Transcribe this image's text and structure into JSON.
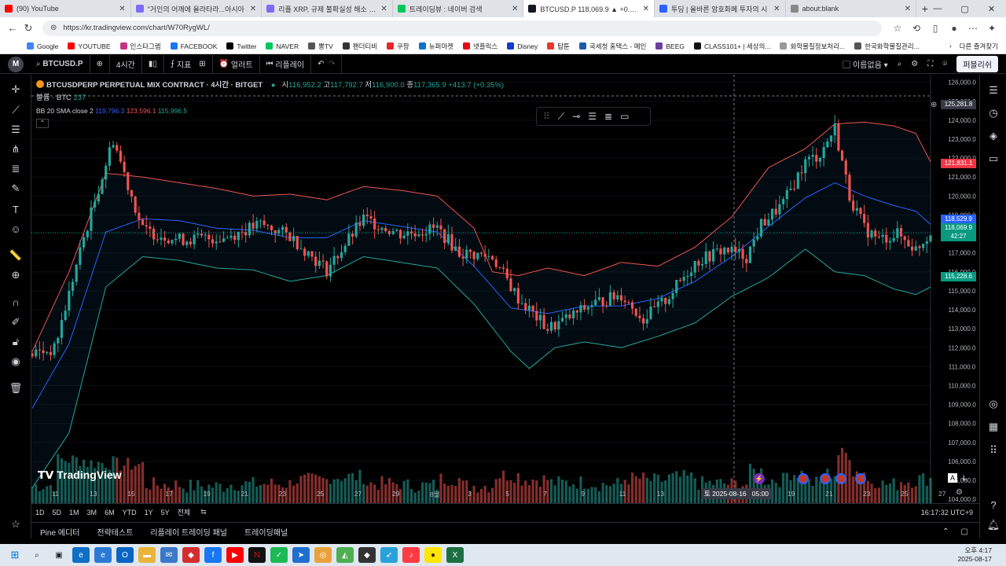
{
  "tabs": [
    {
      "title": "(90) YouTube",
      "color": "#ff0000"
    },
    {
      "title": "\"거인의 어깨에 올라타라...아시아",
      "color": "#7b6df7"
    },
    {
      "title": "리플 XRP, 규제 불확실성 해소 기대",
      "color": "#7b6df7"
    },
    {
      "title": "트레이딩뷰 : 네이버 검색",
      "color": "#03c75a"
    },
    {
      "title": "BTCUSD.P 118,069.9 ▲ +0.55% 이",
      "color": "#131722"
    },
    {
      "title": "투딩 | 올바른 암호화폐 투자의 시",
      "color": "#2962ff"
    },
    {
      "title": "about:blank",
      "color": "#888888"
    }
  ],
  "window_controls": [
    "—",
    "▢",
    "✕"
  ],
  "address": {
    "url": "https://kr.tradingview.com/chart/W70RygWL/"
  },
  "bookmarks": [
    {
      "label": "Google",
      "color": "#4285f4"
    },
    {
      "label": "YOUTUBE",
      "color": "#ff0000"
    },
    {
      "label": "인스타그램",
      "color": "#c13584"
    },
    {
      "label": "FACEBOOK",
      "color": "#1877f2"
    },
    {
      "label": "Twitter",
      "color": "#000000"
    },
    {
      "label": "NAVER",
      "color": "#03c75a"
    },
    {
      "label": "뽕TV",
      "color": "#555555"
    },
    {
      "label": "팬더티비",
      "color": "#333333"
    },
    {
      "label": "쿠팡",
      "color": "#e52528"
    },
    {
      "label": "뉴퍼마켓",
      "color": "#0b73c9"
    },
    {
      "label": "넷플릭스",
      "color": "#e50914"
    },
    {
      "label": "Disney",
      "color": "#113ccf"
    },
    {
      "label": "탑툰",
      "color": "#e8382b"
    },
    {
      "label": "국세청 홈택스 - 메인",
      "color": "#1d5ba8"
    },
    {
      "label": "BEEG",
      "color": "#6b3fa0"
    },
    {
      "label": "CLASS101+ | 세상의...",
      "color": "#111111"
    },
    {
      "label": "화학물질정보처리...",
      "color": "#999999"
    },
    {
      "label": "한국화학물질관리...",
      "color": "#555555"
    }
  ],
  "bookmarks_other": "다른 즐겨찾기",
  "tv_toolbar": {
    "logo": "M",
    "symbol": "BTCUSD.P",
    "interval": "4시간",
    "indicators": "지표",
    "alert": "얼러트",
    "replay": "리플레이",
    "layout_name": "이름없음",
    "publish": "퍼블리쉬"
  },
  "legend": {
    "title": "BTCUSDPERP PERPETUAL MIX CONTRACT · 4시간 · BITGET",
    "ohlc": {
      "o_label": "시",
      "o": "116,952.2",
      "h_label": "고",
      "h": "117,792.7",
      "l_label": "저",
      "l": "116,900.0",
      "c_label": "종",
      "c": "117,365.9",
      "chg": "+413.7 (+0.35%)"
    },
    "volume": "볼륨 · BTC",
    "volume_value": "237",
    "bb": "BB 20 SMA close 2",
    "bb_basis": "119,796.3",
    "bb_upper": "123,596.1",
    "bb_lower": "115,996.5"
  },
  "price_labels": {
    "crosshair": "125,281.8",
    "upper_band": "121,831.1",
    "basis": "118,529.9",
    "last": "118,069.9",
    "countdown": "42:27",
    "lower_band": "115,228.6"
  },
  "time_axis": {
    "crosshair": "토 2025-08-16",
    "crosshair_time": "05:00"
  },
  "watermark": "TradingView",
  "scale_mode": [
    "A",
    "L"
  ],
  "range_buttons": [
    "1D",
    "5D",
    "1M",
    "3M",
    "6M",
    "YTD",
    "1Y",
    "5Y",
    "전체"
  ],
  "utc_clock": "16:17:32 UTC+9",
  "panels": [
    "Pine 에디터",
    "전략테스트",
    "리플레이 트레이딩 패널",
    "트레이딩패널"
  ],
  "taskbar_clock": {
    "time": "오후 4:17",
    "date": "2025-08-17"
  },
  "chart_data": {
    "type": "candlestick",
    "title": "BTCUSDPERP PERPETUAL MIX CONTRACT · 4시간 · BITGET",
    "y_ticks": [
      126000,
      125000,
      124000,
      123000,
      122000,
      121000,
      120000,
      119000,
      118000,
      117000,
      116000,
      115000,
      114000,
      113000,
      112000,
      111000,
      110000,
      109000,
      108000,
      107000,
      106000,
      105000,
      104000
    ],
    "y_range": [
      103800,
      126400
    ],
    "x_ticks": [
      "11",
      "13",
      "15",
      "17",
      "19",
      "21",
      "23",
      "25",
      "27",
      "29",
      "8월",
      "3",
      "5",
      "7",
      "9",
      "11",
      "13",
      "19",
      "21",
      "23",
      "25",
      "27"
    ],
    "colors": {
      "up": "#26a69a",
      "down": "#ef5350",
      "bb_upper": "#ef5350",
      "bb_lower": "#26a69a",
      "bb_basis": "#2962ff"
    },
    "close_path": [
      [
        0,
        111700
      ],
      [
        6,
        111900
      ],
      [
        14,
        117800
      ],
      [
        22,
        123000
      ],
      [
        30,
        118200
      ],
      [
        40,
        117700
      ],
      [
        52,
        117800
      ],
      [
        62,
        118500
      ],
      [
        70,
        117900
      ],
      [
        80,
        116100
      ],
      [
        90,
        118800
      ],
      [
        100,
        118000
      ],
      [
        110,
        118300
      ],
      [
        116,
        117000
      ],
      [
        125,
        116800
      ],
      [
        132,
        114600
      ],
      [
        140,
        113000
      ],
      [
        146,
        113600
      ],
      [
        152,
        114300
      ],
      [
        160,
        114800
      ],
      [
        166,
        113500
      ],
      [
        172,
        114500
      ],
      [
        180,
        116500
      ],
      [
        188,
        117200
      ],
      [
        194,
        116800
      ],
      [
        198,
        118500
      ],
      [
        204,
        119600
      ],
      [
        210,
        121800
      ],
      [
        214,
        122200
      ],
      [
        218,
        123600
      ],
      [
        222,
        120000
      ],
      [
        226,
        118300
      ],
      [
        230,
        117700
      ],
      [
        235,
        118000
      ],
      [
        240,
        117200
      ],
      [
        244,
        118070
      ]
    ],
    "bb_upper_path": [
      [
        0,
        111800
      ],
      [
        10,
        116000
      ],
      [
        20,
        121200
      ],
      [
        30,
        121000
      ],
      [
        40,
        120700
      ],
      [
        50,
        120400
      ],
      [
        60,
        120000
      ],
      [
        70,
        120100
      ],
      [
        80,
        119800
      ],
      [
        90,
        120500
      ],
      [
        100,
        120300
      ],
      [
        110,
        120000
      ],
      [
        120,
        118300
      ],
      [
        125,
        116000
      ],
      [
        132,
        115800
      ],
      [
        140,
        116200
      ],
      [
        150,
        115800
      ],
      [
        160,
        116500
      ],
      [
        170,
        116300
      ],
      [
        180,
        117300
      ],
      [
        190,
        118900
      ],
      [
        200,
        121500
      ],
      [
        210,
        122500
      ],
      [
        218,
        123800
      ],
      [
        226,
        123900
      ],
      [
        234,
        123700
      ],
      [
        240,
        123300
      ],
      [
        244,
        121800
      ]
    ],
    "bb_lower_path": [
      [
        0,
        104600
      ],
      [
        10,
        107500
      ],
      [
        20,
        115200
      ],
      [
        30,
        116800
      ],
      [
        40,
        116600
      ],
      [
        50,
        116200
      ],
      [
        60,
        116100
      ],
      [
        70,
        115500
      ],
      [
        80,
        115800
      ],
      [
        90,
        116800
      ],
      [
        100,
        116500
      ],
      [
        110,
        116200
      ],
      [
        120,
        114300
      ],
      [
        130,
        111800
      ],
      [
        135,
        110900
      ],
      [
        142,
        112000
      ],
      [
        150,
        112300
      ],
      [
        160,
        112000
      ],
      [
        170,
        112600
      ],
      [
        180,
        113300
      ],
      [
        190,
        114700
      ],
      [
        200,
        115700
      ],
      [
        210,
        117200
      ],
      [
        218,
        116000
      ],
      [
        226,
        115800
      ],
      [
        234,
        115100
      ],
      [
        240,
        114800
      ],
      [
        244,
        115200
      ]
    ],
    "basis_path": [
      [
        0,
        108800
      ],
      [
        10,
        112200
      ],
      [
        20,
        118100
      ],
      [
        30,
        118800
      ],
      [
        40,
        118700
      ],
      [
        50,
        118300
      ],
      [
        60,
        118200
      ],
      [
        70,
        117800
      ],
      [
        80,
        117800
      ],
      [
        90,
        118700
      ],
      [
        100,
        118400
      ],
      [
        110,
        118100
      ],
      [
        120,
        116300
      ],
      [
        130,
        114100
      ],
      [
        140,
        113800
      ],
      [
        150,
        114200
      ],
      [
        160,
        114200
      ],
      [
        170,
        114600
      ],
      [
        180,
        115500
      ],
      [
        190,
        116800
      ],
      [
        200,
        118400
      ],
      [
        210,
        119900
      ],
      [
        218,
        120700
      ],
      [
        226,
        120000
      ],
      [
        234,
        119500
      ],
      [
        240,
        119200
      ],
      [
        244,
        118500
      ]
    ],
    "volume_max": 2600
  }
}
